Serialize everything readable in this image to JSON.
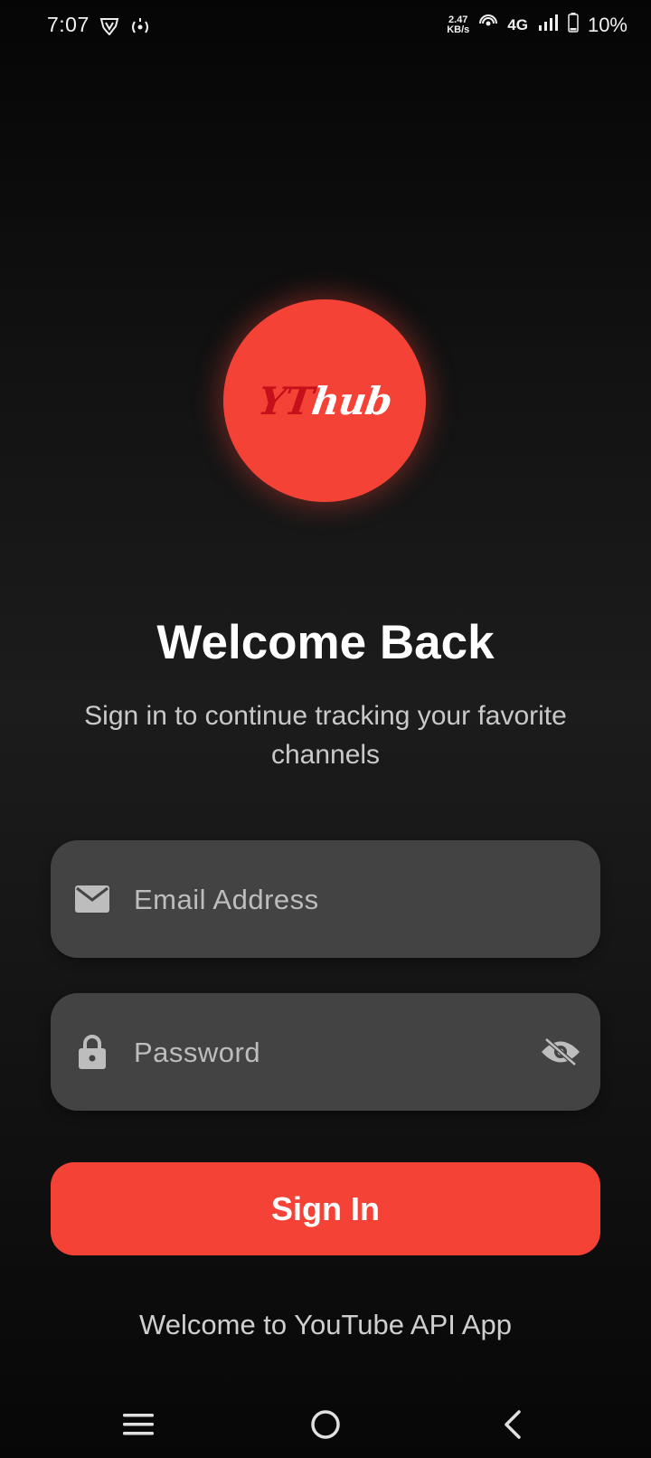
{
  "status_bar": {
    "time": "7:07",
    "net_speed_value": "2.47",
    "net_speed_unit": "KB/s",
    "network_type": "4G",
    "battery": "10%",
    "icons": [
      "vpn-shield-icon",
      "hotspot-icon",
      "wifi-calling-icon",
      "signal-icon",
      "battery-icon"
    ]
  },
  "logo": {
    "text_yt": "YT",
    "text_hub": "hub",
    "colors": {
      "circle": "#f44336",
      "yt": "#c4101a",
      "hub": "#ffffff"
    }
  },
  "heading": {
    "title": "Welcome Back",
    "subtitle": "Sign in to continue tracking your favorite channels"
  },
  "form": {
    "email": {
      "placeholder": "Email Address",
      "value": "",
      "icon": "mail-icon"
    },
    "password": {
      "placeholder": "Password",
      "value": "",
      "icon": "lock-icon",
      "toggle_icon": "eye-off-icon"
    },
    "submit_label": "Sign In"
  },
  "footer": {
    "text": "Welcome to YouTube API App"
  },
  "nav_bar": {
    "icons": [
      "menu-icon",
      "home-icon",
      "back-icon"
    ]
  },
  "colors": {
    "accent": "#f44336",
    "field_bg": "#434343",
    "text_secondary": "#c9c9c9"
  }
}
